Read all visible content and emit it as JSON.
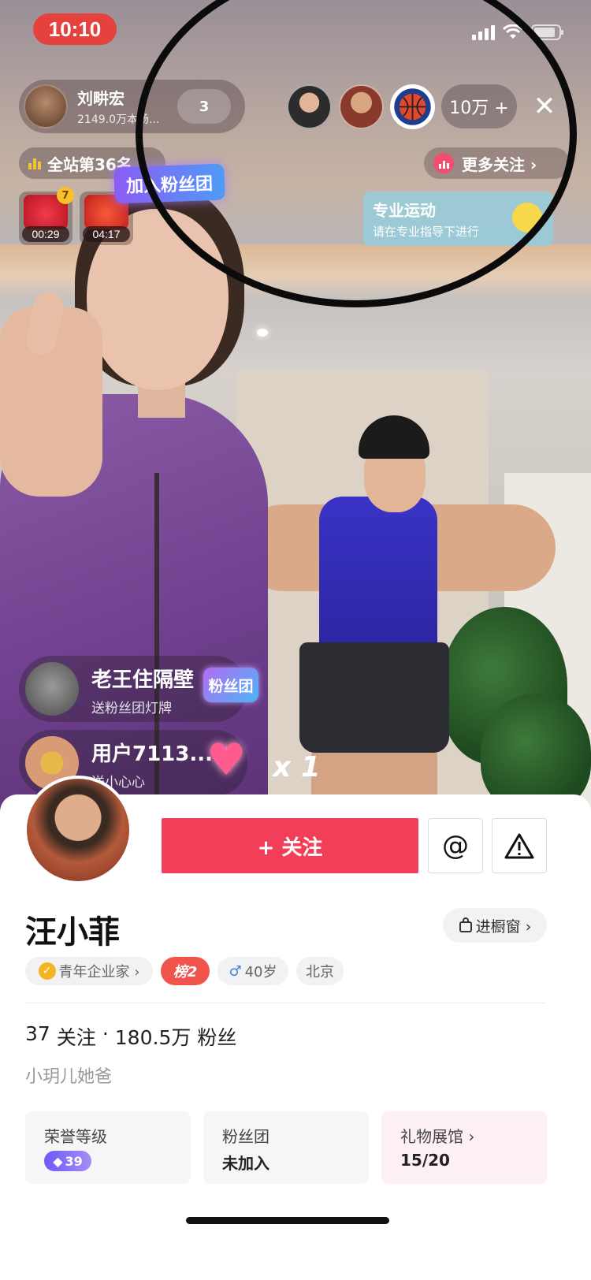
{
  "status_bar": {
    "time": "10:10"
  },
  "streamer": {
    "name": "刘畊宏",
    "stats": "2149.0万本场...",
    "heart_count": "3"
  },
  "top_right": {
    "viewer_count": "10万 +",
    "close_icon": "close-icon"
  },
  "rank": {
    "label": "全站第36名"
  },
  "more_follow": {
    "label": "更多关注 ›"
  },
  "gifts": [
    {
      "timer": "00:29",
      "count": "7"
    },
    {
      "timer": "04:17"
    }
  ],
  "fan_join_banner": "加入粉丝团",
  "sport_notice": {
    "title": "专业运动",
    "subtitle": "请在专业指导下进行"
  },
  "chat": [
    {
      "name": "老王住隔壁",
      "message": "送粉丝团灯牌",
      "badge": "粉丝团"
    },
    {
      "name": "用户7113...",
      "message": "送小心心",
      "multiplier": "x 1"
    }
  ],
  "profile": {
    "follow_label": "+ 关注",
    "mention_icon": "at-icon",
    "report_icon": "warning-icon",
    "name": "汪小菲",
    "shop_label": "进橱窗 ›",
    "tags": {
      "title": "青年企业家 ›",
      "rank": "榜2",
      "age": "40岁",
      "city": "北京"
    },
    "following": "37",
    "following_label": "关注",
    "separator": "·",
    "fans": "180.5万",
    "fans_label": "粉丝",
    "bio": "小玥儿她爸",
    "cards": [
      {
        "title": "荣誉等级",
        "value": "39"
      },
      {
        "title": "粉丝团",
        "value": "未加入"
      },
      {
        "title": "礼物展馆 ›",
        "value": "15/20"
      }
    ]
  },
  "colors": {
    "follow_red": "#f33e5a",
    "time_pill": "#e5423e",
    "rank_pill": "#f1544d"
  }
}
